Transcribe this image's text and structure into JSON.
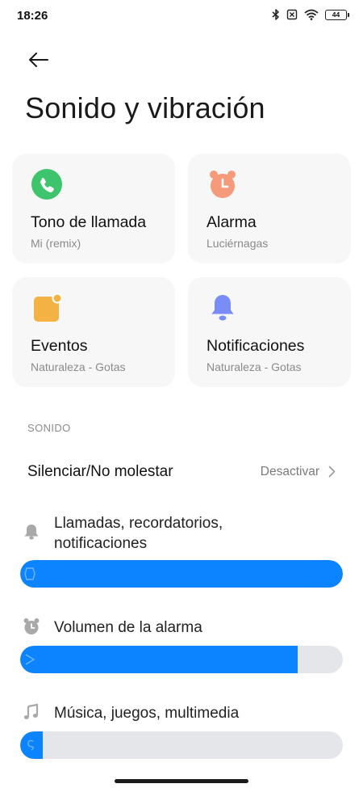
{
  "status_bar": {
    "time": "18:26",
    "battery": "44",
    "icons": [
      "bluetooth-icon",
      "no-sim-icon",
      "wifi-icon",
      "battery-icon"
    ]
  },
  "header": {
    "back_icon": "arrow-left-icon",
    "title": "Sonido y vibración"
  },
  "cards": [
    {
      "title": "Tono de llamada",
      "subtitle": "Mi (remix)",
      "icon": "phone-icon",
      "color": "#3ec46d"
    },
    {
      "title": "Alarma",
      "subtitle": "Luciérnagas",
      "icon": "alarm-clock-icon",
      "color": "#f59a7a"
    },
    {
      "title": "Eventos",
      "subtitle": "Naturaleza - Gotas",
      "icon": "calendar-event-icon",
      "color": "#f4b244"
    },
    {
      "title": "Notificaciones",
      "subtitle": "Naturaleza - Gotas",
      "icon": "bell-icon",
      "color": "#7a8cf5"
    }
  ],
  "section": {
    "label": "SONIDO"
  },
  "dnd": {
    "title": "Silenciar/No molestar",
    "value": "Desactivar"
  },
  "volumes": [
    {
      "label_line1": "Llamadas, recordatorios,",
      "label_line2": "notificaciones",
      "icon": "bell-icon",
      "level": 1.0
    },
    {
      "label_line1": "Volumen de la alarma",
      "label_line2": "",
      "icon": "alarm-clock-icon",
      "level": 0.86
    },
    {
      "label_line1": "Música, juegos, multimedia",
      "label_line2": "",
      "icon": "music-note-icon",
      "level": 0.07
    }
  ],
  "colors": {
    "accent": "#0d84ff",
    "track": "#e4e6ea",
    "card_bg": "#f7f7f7"
  }
}
